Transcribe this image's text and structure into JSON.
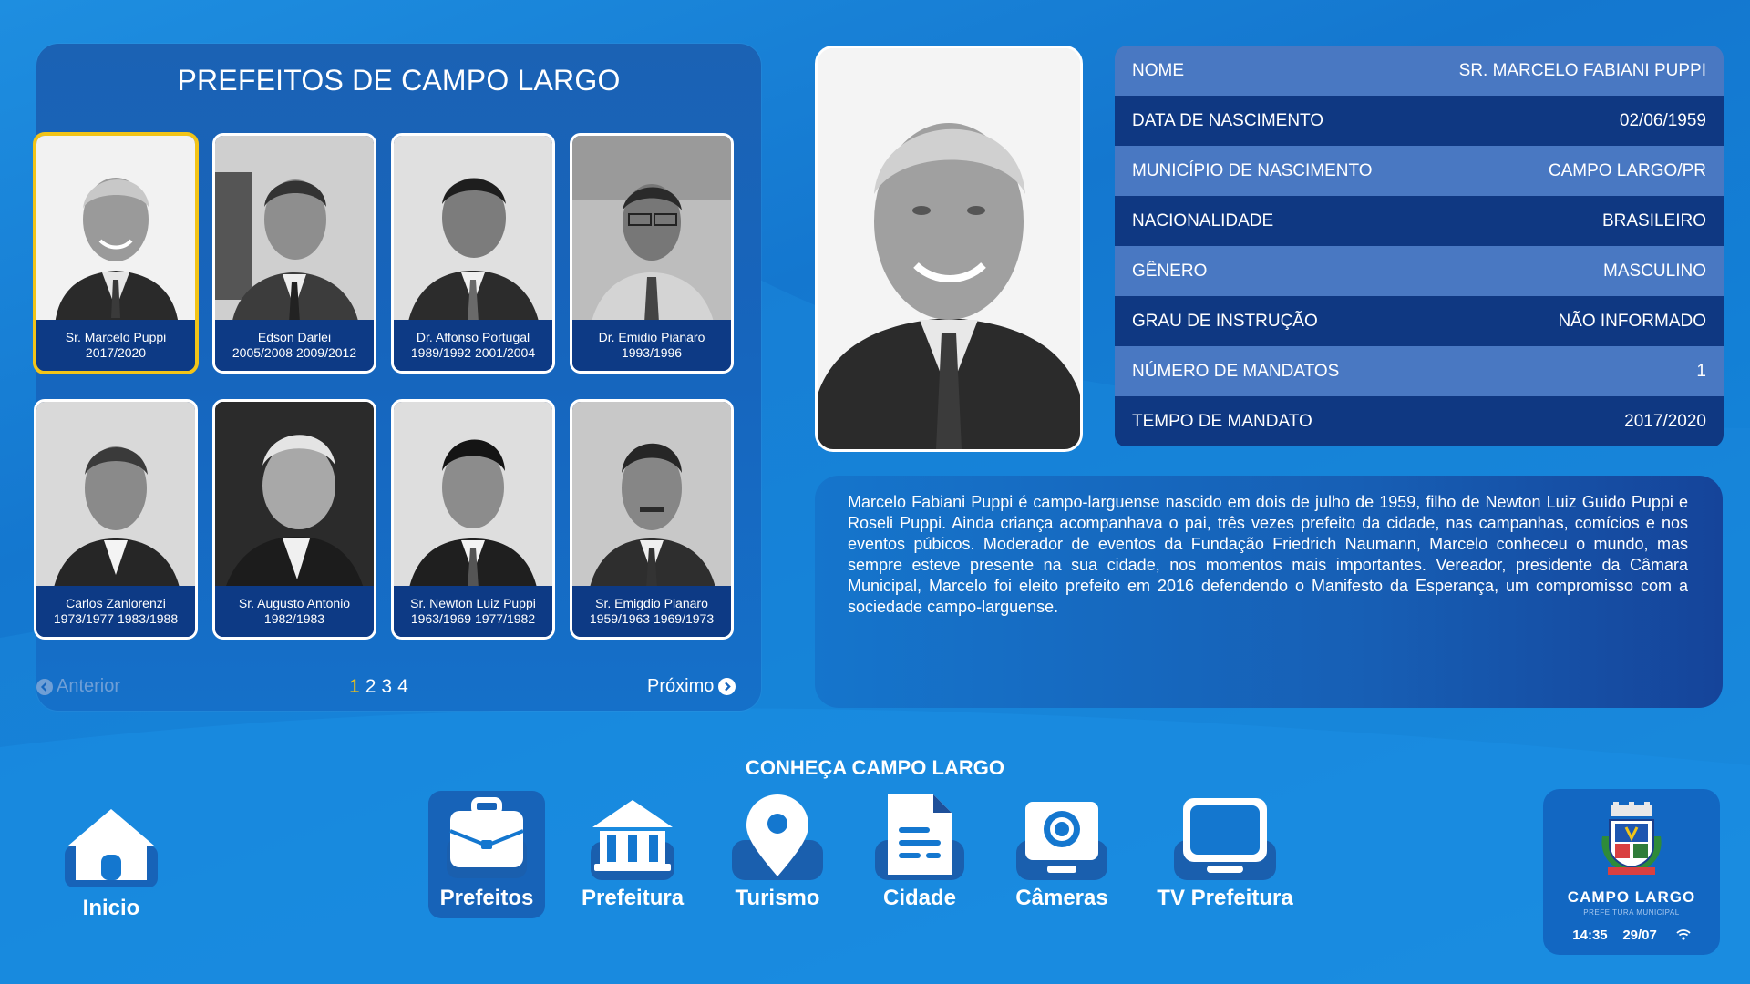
{
  "panel": {
    "title": "PREFEITOS DE CAMPO LARGO",
    "mayors": [
      {
        "name": "Sr. Marcelo Puppi",
        "terms": "2017/2020",
        "selected": true
      },
      {
        "name": "Edson Darlei",
        "terms": "2005/2008 2009/2012",
        "selected": false
      },
      {
        "name": "Dr. Affonso Portugal",
        "terms": "1989/1992 2001/2004",
        "selected": false
      },
      {
        "name": "Dr. Emidio Pianaro",
        "terms": "1993/1996",
        "selected": false
      },
      {
        "name": "Carlos Zanlorenzi",
        "terms": "1973/1977 1983/1988",
        "selected": false
      },
      {
        "name": "Sr. Augusto Antonio",
        "terms": "1982/1983",
        "selected": false
      },
      {
        "name": "Sr. Newton Luiz Puppi",
        "terms": "1963/1969 1977/1982",
        "selected": false
      },
      {
        "name": "Sr. Emigdio Pianaro",
        "terms": "1959/1963 1969/1973",
        "selected": false
      }
    ],
    "pagination": {
      "prev_label": "Anterior",
      "next_label": "Próximo",
      "pages": [
        "1",
        "2",
        "3",
        "4"
      ],
      "current_page": "1"
    }
  },
  "details": {
    "rows": [
      {
        "label": "NOME",
        "value": "SR. MARCELO FABIANI PUPPI"
      },
      {
        "label": "DATA DE NASCIMENTO",
        "value": "02/06/1959"
      },
      {
        "label": "MUNICÍPIO DE NASCIMENTO",
        "value": "CAMPO LARGO/PR"
      },
      {
        "label": "NACIONALIDADE",
        "value": "BRASILEIRO"
      },
      {
        "label": "GÊNERO",
        "value": "MASCULINO"
      },
      {
        "label": "GRAU DE INSTRUÇÃO",
        "value": "NÃO INFORMADO"
      },
      {
        "label": "NÚMERO DE MANDATOS",
        "value": "1"
      },
      {
        "label": "TEMPO DE MANDATO",
        "value": "2017/2020"
      }
    ],
    "bio": "Marcelo Fabiani Puppi é campo-larguense nascido em dois de julho de 1959, filho de Newton Luiz Guido Puppi e Roseli Puppi. Ainda criança acompanhava o pai, três vezes prefeito da cidade, nas campanhas, comícios e nos eventos púbicos. Moderador de eventos da Fundação Friedrich Naumann, Marcelo conheceu o mundo, mas sempre esteve presente na sua cidade, nos momentos mais importantes. Vereador, presidente da Câmara Municipal, Marcelo foi eleito prefeito em 2016 defendendo o Manifesto da Esperança, um compromisso com a sociedade campo-larguense."
  },
  "bottom": {
    "section_title": "CONHEÇA CAMPO LARGO",
    "home_label": "Inicio",
    "nav": [
      {
        "label": "Prefeitos",
        "icon": "briefcase-icon",
        "active": true
      },
      {
        "label": "Prefeitura",
        "icon": "bank-building-icon",
        "active": false
      },
      {
        "label": "Turismo",
        "icon": "map-pin-icon",
        "active": false
      },
      {
        "label": "Cidade",
        "icon": "document-icon",
        "active": false
      },
      {
        "label": "Câmeras",
        "icon": "camera-icon",
        "active": false
      },
      {
        "label": "TV Prefeitura",
        "icon": "tv-icon",
        "active": false
      }
    ]
  },
  "branding": {
    "name": "CAMPO LARGO",
    "subtitle": "PREFEITURA MUNICIPAL",
    "time": "14:35",
    "date": "29/07"
  },
  "colors": {
    "accent": "#f2c418",
    "panel": "#1665bd",
    "row_dark": "#0f3882",
    "row_light": "#4978c2"
  }
}
